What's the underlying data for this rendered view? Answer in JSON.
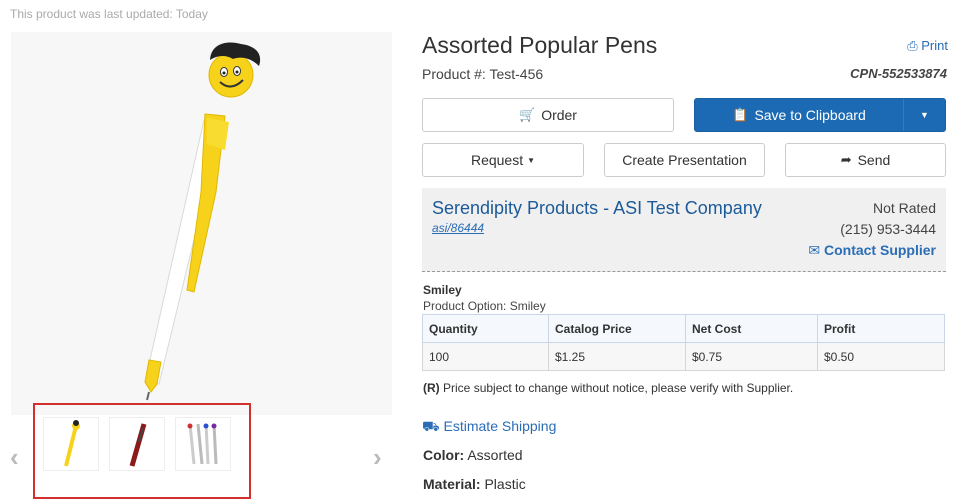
{
  "last_updated": "This product was last updated: Today",
  "product": {
    "title": "Assorted Popular Pens",
    "product_number": "Product #: Test-456",
    "cpn": "CPN-552533874",
    "print_label": "Print"
  },
  "actions": {
    "order_label": "Order",
    "save_label": "Save to Clipboard",
    "request_label": "Request",
    "create_presentation_label": "Create Presentation",
    "send_label": "Send"
  },
  "supplier": {
    "name": "Serendipity Products - ASI Test Company",
    "asi": "asi/86444",
    "rating": "Not Rated",
    "phone": "(215) 953-3444",
    "contact_label": "Contact Supplier"
  },
  "option": {
    "name": "Smiley",
    "line": "Product Option: Smiley"
  },
  "pricing": {
    "headers": [
      "Quantity",
      "Catalog Price",
      "Net Cost",
      "Profit"
    ],
    "rows": [
      [
        "100",
        "$1.25",
        "$0.75",
        "$0.50"
      ]
    ]
  },
  "note": {
    "code": "(R)",
    "text": "Price subject to change without notice, please verify with Supplier."
  },
  "shipping_label": "Estimate Shipping",
  "attributes": {
    "color_label": "Color:",
    "color_value": "Assorted",
    "material_label": "Material:",
    "material_value": "Plastic"
  },
  "icons": {
    "print": "print-icon",
    "order": "cart-icon",
    "save": "clipboard-icon",
    "send": "share-icon",
    "contact": "envelope-icon",
    "shipping": "truck-icon"
  },
  "colors": {
    "primary": "#1c6ab3",
    "link": "#2a6db5",
    "highlight_border": "#d32f2f"
  }
}
